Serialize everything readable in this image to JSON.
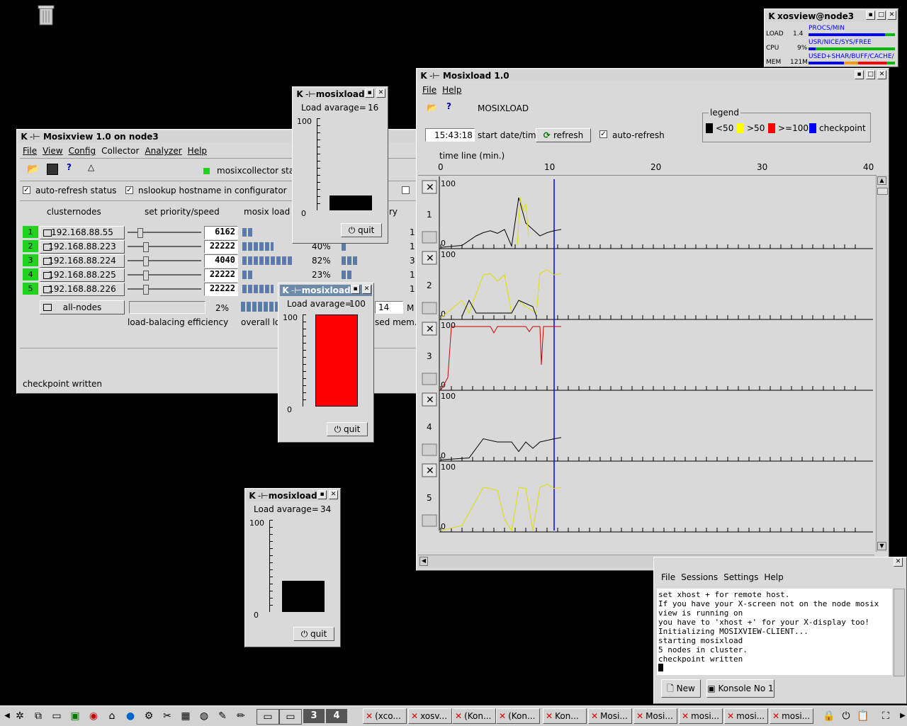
{
  "desktop": {
    "trash_icon": "trash-icon"
  },
  "xosview": {
    "title": "xosview@node3",
    "load_label": "LOAD",
    "load_val": "1.4",
    "procs": "PROCS/MIN",
    "cpu_label": "CPU",
    "cpu_val": "9%",
    "cpu_legend": "USR/NICE/SYS/FREE",
    "mem_label": "MEM",
    "mem_val": "121M",
    "mem_legend": "USED+SHAR/BUFF/CACHE/"
  },
  "mosixview": {
    "title": "Mosixview 1.0  on node3",
    "menu": [
      "File",
      "View",
      "Config",
      "Collector",
      "Analyzer",
      "Help"
    ],
    "collector_status": "mosixcollector status",
    "auto_refresh": "auto-refresh status",
    "nslookup": "nslookup hostname in configurator",
    "col_clusternodes": "clusternodes",
    "col_priority": "set priority/speed",
    "col_mosix_load": "mosix load",
    "col_memory": "ry",
    "nodes": [
      {
        "num": "1",
        "ip": "192.168.88.55",
        "speed": "6162",
        "pct": "",
        "tail": "1"
      },
      {
        "num": "2",
        "ip": "192.168.88.223",
        "speed": "22222",
        "pct": "40%",
        "tail": "1"
      },
      {
        "num": "3",
        "ip": "192.168.88.224",
        "speed": "4040",
        "pct": "82%",
        "tail": "3"
      },
      {
        "num": "4",
        "ip": "192.168.88.225",
        "speed": "22222",
        "pct": "23%",
        "tail": "1"
      },
      {
        "num": "5",
        "ip": "192.168.88.226",
        "speed": "22222",
        "pct": "",
        "tail": "1"
      }
    ],
    "all_nodes": "all-nodes",
    "efficiency_pct": "2%",
    "efficiency_label": "load-balacing efficiency",
    "overall_label": "overall lo",
    "mem_field": "14",
    "mem_unit": "M",
    "used_mem": "sed mem.",
    "status": "checkpoint written"
  },
  "mosixload_small": [
    {
      "title": "mosixload",
      "load_label": "Load avarage=",
      "load": "16",
      "max": "100",
      "min": "0",
      "fill": 0.16,
      "color": "#000000",
      "quit": "quit"
    },
    {
      "title": "mosixload",
      "load_label": "Load avarage=",
      "load": "100",
      "max": "100",
      "min": "0",
      "fill": 1.0,
      "color": "#ff0000",
      "quit": "quit"
    },
    {
      "title": "mosixload",
      "load_label": "Load avarage=",
      "load": "34",
      "max": "100",
      "min": "0",
      "fill": 0.34,
      "color": "#000000",
      "quit": "quit"
    }
  ],
  "mosixload_main": {
    "title": "Mosixload 1.0",
    "menu": [
      "File",
      "Help"
    ],
    "app_label": "MOSIXLOAD",
    "time": "15:43:18",
    "start_label": "start date/time",
    "refresh": "refresh",
    "auto_refresh": "auto-refresh",
    "legend_title": "legend",
    "legend": [
      {
        "label": "<50",
        "color": "#000000"
      },
      {
        "label": ">50",
        "color": "#ffff00"
      },
      {
        "label": ">=100!",
        "color": "#ff0000"
      },
      {
        "label": "checkpoint",
        "color": "#0000ff"
      }
    ],
    "timeline_label": "time line (min.)",
    "ticks": [
      "0",
      "10",
      "20",
      "30",
      "40"
    ],
    "rows": [
      {
        "num": "1",
        "max": "100",
        "min": "0"
      },
      {
        "num": "2",
        "max": "100",
        "min": "0"
      },
      {
        "num": "3",
        "max": "100",
        "min": "0"
      },
      {
        "num": "4",
        "max": "100",
        "min": "0"
      },
      {
        "num": "5",
        "max": "100",
        "min": "0"
      }
    ]
  },
  "konsole": {
    "menu": [
      "File",
      "Sessions",
      "Settings",
      "Help"
    ],
    "lines": [
      "set xhost + for remote host.",
      "If you have your X-screen not on the node mosix",
      "view is running on",
      "you have to 'xhost +' for your X-display too!",
      "Initializing MOSIXVIEW-CLIENT...",
      "starting mosixload",
      "5 nodes in cluster.",
      "checkpoint written"
    ],
    "new_label": "New",
    "tab_label": "Konsole No 1"
  },
  "taskbar": {
    "desk3": "3",
    "desk4": "4",
    "tasks": [
      "(xco...",
      "xosv...",
      "(Kon...",
      "(Kon...",
      "Kon...",
      "Mosi...",
      "Mosi...",
      "mosi...",
      "mosi...",
      "mosi..."
    ]
  }
}
